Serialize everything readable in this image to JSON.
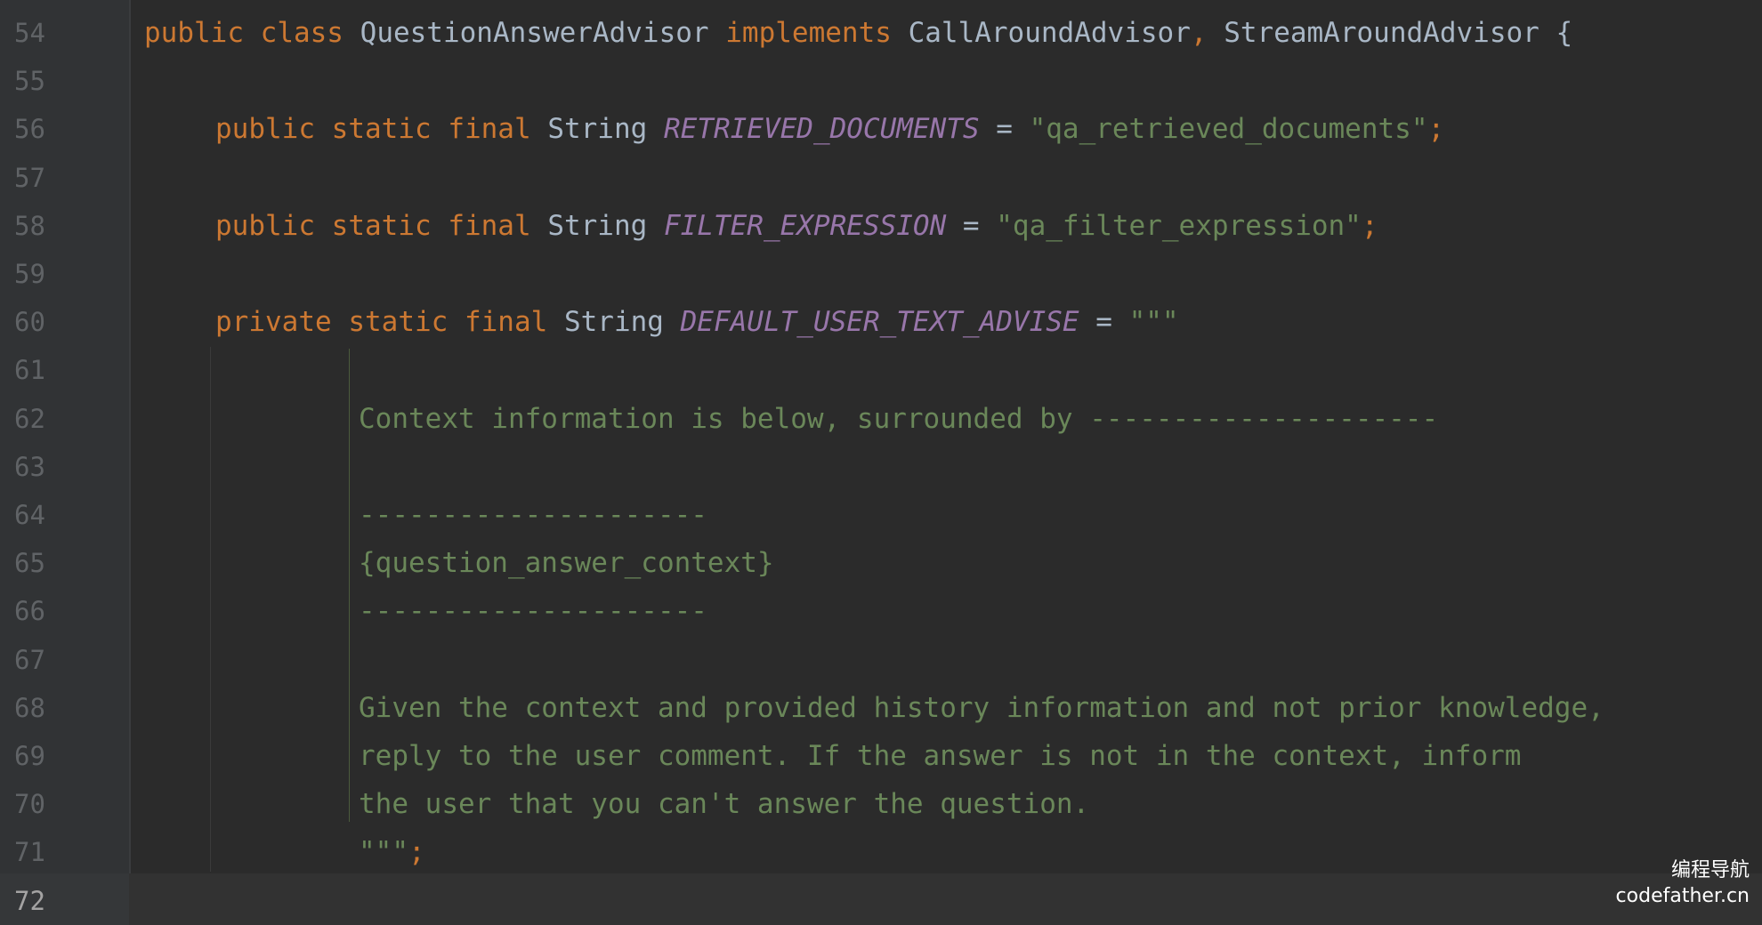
{
  "editor": {
    "lines": [
      {
        "number": "54",
        "tokens": [
          {
            "t": "public",
            "c": "kw"
          },
          {
            "t": " "
          },
          {
            "t": "class",
            "c": "kw"
          },
          {
            "t": " "
          },
          {
            "t": "QuestionAnswerAdvisor",
            "c": "cls"
          },
          {
            "t": " "
          },
          {
            "t": "implements",
            "c": "kw"
          },
          {
            "t": " "
          },
          {
            "t": "CallAroundAdvisor",
            "c": "cls"
          },
          {
            "t": ",",
            "c": "kw"
          },
          {
            "t": " "
          },
          {
            "t": "StreamAroundAdvisor",
            "c": "cls"
          },
          {
            "t": " {"
          }
        ]
      },
      {
        "number": "55",
        "tokens": []
      },
      {
        "number": "56",
        "tokens": [
          {
            "t": "public",
            "c": "kw"
          },
          {
            "t": " "
          },
          {
            "t": "static",
            "c": "kw"
          },
          {
            "t": " "
          },
          {
            "t": "final",
            "c": "kw"
          },
          {
            "t": " "
          },
          {
            "t": "String",
            "c": "cls"
          },
          {
            "t": " "
          },
          {
            "t": "RETRIEVED_DOCUMENTS",
            "c": "const"
          },
          {
            "t": " = "
          },
          {
            "t": "\"qa_retrieved_documents\"",
            "c": "str"
          },
          {
            "t": ";",
            "c": "kw"
          }
        ]
      },
      {
        "number": "57",
        "tokens": []
      },
      {
        "number": "58",
        "tokens": [
          {
            "t": "public",
            "c": "kw"
          },
          {
            "t": " "
          },
          {
            "t": "static",
            "c": "kw"
          },
          {
            "t": " "
          },
          {
            "t": "final",
            "c": "kw"
          },
          {
            "t": " "
          },
          {
            "t": "String",
            "c": "cls"
          },
          {
            "t": " "
          },
          {
            "t": "FILTER_EXPRESSION",
            "c": "const"
          },
          {
            "t": " = "
          },
          {
            "t": "\"qa_filter_expression\"",
            "c": "str"
          },
          {
            "t": ";",
            "c": "kw"
          }
        ]
      },
      {
        "number": "59",
        "tokens": []
      },
      {
        "number": "60",
        "tokens": [
          {
            "t": "private",
            "c": "kw"
          },
          {
            "t": " "
          },
          {
            "t": "static",
            "c": "kw"
          },
          {
            "t": " "
          },
          {
            "t": "final",
            "c": "kw"
          },
          {
            "t": " "
          },
          {
            "t": "String",
            "c": "cls"
          },
          {
            "t": " "
          },
          {
            "t": "DEFAULT_USER_TEXT_ADVISE",
            "c": "const"
          },
          {
            "t": " = "
          },
          {
            "t": "\"\"\"",
            "c": "str"
          }
        ]
      },
      {
        "number": "61",
        "tokens": []
      },
      {
        "number": "62",
        "tokens": [
          {
            "t": "Context information is below, surrounded by ---------------------",
            "c": "str"
          }
        ]
      },
      {
        "number": "63",
        "tokens": []
      },
      {
        "number": "64",
        "tokens": [
          {
            "t": "---------------------",
            "c": "str"
          }
        ]
      },
      {
        "number": "65",
        "tokens": [
          {
            "t": "{question_answer_context}",
            "c": "str"
          }
        ]
      },
      {
        "number": "66",
        "tokens": [
          {
            "t": "---------------------",
            "c": "str"
          }
        ]
      },
      {
        "number": "67",
        "tokens": []
      },
      {
        "number": "68",
        "tokens": [
          {
            "t": "Given the context and provided history information and not prior knowledge,",
            "c": "str"
          }
        ]
      },
      {
        "number": "69",
        "tokens": [
          {
            "t": "reply to the user comment. If the answer is not in the context, inform",
            "c": "str"
          }
        ]
      },
      {
        "number": "70",
        "tokens": [
          {
            "t": "the user that you can't answer the question.",
            "c": "str"
          }
        ]
      },
      {
        "number": "71",
        "tokens": [
          {
            "t": "\"\"\"",
            "c": "str"
          },
          {
            "t": ";",
            "c": "kw"
          }
        ]
      },
      {
        "number": "72",
        "tokens": [],
        "active": true
      }
    ]
  },
  "watermark": {
    "line1": "编程导航",
    "line2": "codefather.cn"
  },
  "colors": {
    "background": "#2b2b2b",
    "keyword": "#cc7832",
    "identifier": "#a9b7c6",
    "constant": "#9876aa",
    "string": "#6a8759",
    "line_number": "#606366"
  }
}
